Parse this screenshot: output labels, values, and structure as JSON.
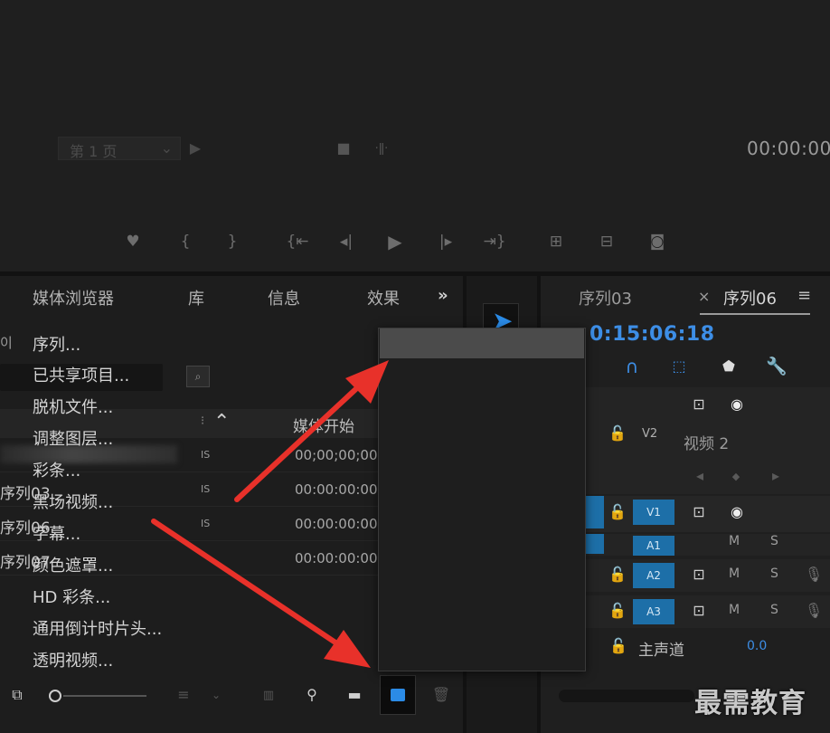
{
  "monitor": {
    "page_select": "第 1 页",
    "timecode": "00:00:00"
  },
  "project_panel": {
    "tabs": [
      "媒体浏览器",
      "库",
      "信息",
      "效果"
    ],
    "more": "»",
    "panel_label": "이",
    "column_header": "媒体开始",
    "rows": [
      {
        "name": "",
        "fps": "IS",
        "tc": "00;00;00;00"
      },
      {
        "name": "序列03",
        "fps": "IS",
        "tc": "00:00:00:00"
      },
      {
        "name": "序列06",
        "fps": "IS",
        "tc": "00:00:00:00"
      },
      {
        "name": "序列07",
        "fps": "",
        "tc": "00:00:00:00"
      }
    ]
  },
  "timeline": {
    "tab1": "序列03",
    "tab1_close": "×",
    "tab2": "序列06",
    "menu_icon": "≡",
    "timecode": "0:15:06:18",
    "tracks": {
      "v2": "V2",
      "v2_name": "视频 2",
      "v1": "V1",
      "a1": "A1",
      "a2": "A2",
      "a3": "A3",
      "m": "M",
      "s": "S",
      "master": "主声道",
      "master_value": "0.0"
    }
  },
  "context_menu": {
    "items": [
      "序列...",
      "已共享项目...",
      "脱机文件...",
      "调整图层...",
      "彩条...",
      "黑场视频...",
      "字幕...",
      "颜色遮罩...",
      "HD 彩条...",
      "通用倒计时片头...",
      "透明视频..."
    ]
  },
  "watermark": "最需教育",
  "colors": {
    "accent_blue": "#1d6fa8",
    "timecode_blue": "#3d8ee6",
    "arrow_red": "#e8312a",
    "menu_highlight": "#4b4b4b"
  }
}
